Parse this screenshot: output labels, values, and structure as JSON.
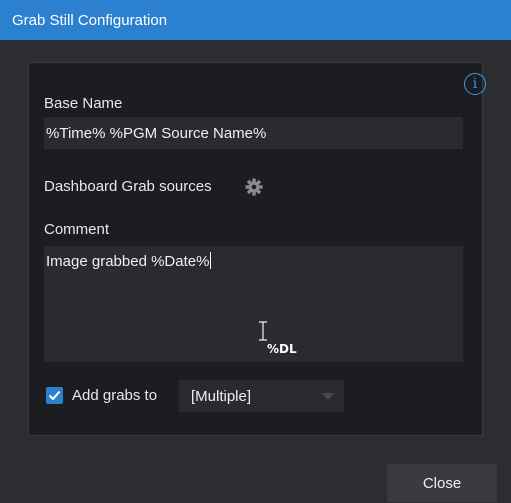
{
  "window": {
    "title": "Grab Still Configuration"
  },
  "form": {
    "base_name_label": "Base Name",
    "base_name_value": "%Time% %PGM Source Name%",
    "dashboard_label": "Dashboard Grab sources",
    "comment_label": "Comment",
    "comment_value": "Image grabbed  %Date%",
    "drag_hint": "%DL",
    "add_grabs_label": "Add grabs to",
    "add_grabs_checked": true,
    "add_grabs_selected": "[Multiple]"
  },
  "footer": {
    "close_label": "Close"
  },
  "icons": {
    "info": "info-icon",
    "settings": "gear-icon",
    "cursor": "ibeam-cursor-icon",
    "checkbox": "check-icon",
    "dropdown": "chevron-down-icon"
  },
  "colors": {
    "accent": "#2b80d0",
    "info": "#3a9be8",
    "panel": "#1c1d20",
    "field": "#2a2b2f"
  }
}
